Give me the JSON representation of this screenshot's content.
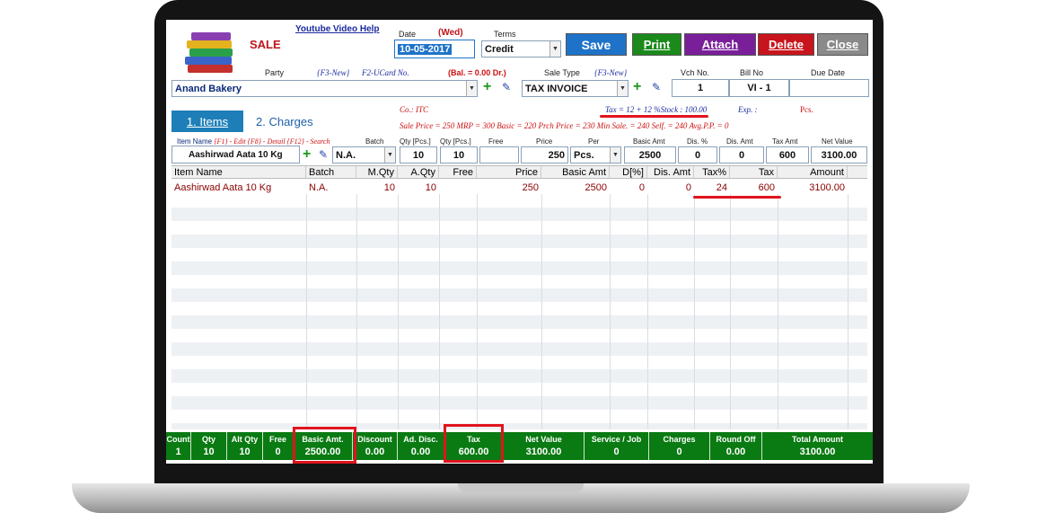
{
  "header": {
    "title": "SALE",
    "help_link": "Youtube Video Help",
    "date_label": "Date",
    "weekday": "(Wed)",
    "date_value": "10-05-2017",
    "terms_label": "Terms",
    "terms_value": "Credit",
    "buttons": {
      "save": "Save",
      "print": "Print",
      "attach": "Attach",
      "delete": "Delete",
      "close": "Close"
    }
  },
  "party": {
    "label": "Party",
    "f3_new": "{F3-New}",
    "f2_ucard": "F2-UCard No.",
    "balance": "(Bal. =  0.00 Dr.)",
    "value": "Anand Bakery",
    "sale_type_label": "Sale Type",
    "sale_type_f3": "{F3-New}",
    "sale_type_value": "TAX INVOICE",
    "vch_label": "Vch No.",
    "vch_value": "1",
    "bill_label": "Bill No",
    "bill_value": "VI - 1",
    "due_label": "Due Date",
    "due_value": ""
  },
  "tabs": {
    "items": "1. Items",
    "charges": "2. Charges"
  },
  "info": {
    "company": "Co.: ITC",
    "tax_stock": "Tax = 12 + 12 %Stock : 100.00",
    "exp": "Exp. :",
    "pcs": "Pcs.",
    "prices": "Sale Price = 250    MRP = 300    Basic = 220    Prch Price = 230    Min Sale. = 240    Self. = 240    Avg.P.P. = 0"
  },
  "entry": {
    "item_name_label": "Item Name",
    "hints": "{F1} - Edit  {F8} - Detail  {F12} - Search",
    "batch_label": "Batch",
    "qty_label": "Qty [Pcs.]",
    "qty2_label": "Qty [Pcs.]",
    "free_label": "Free",
    "price_label": "Price",
    "per_label": "Per",
    "basic_amt_label": "Basic Amt",
    "dis_pct_label": "Dis. %",
    "dis_amt_label": "Dis. Amt",
    "tax_amt_label": "Tax Amt",
    "net_value_label": "Net Value",
    "item_value": "Aashirwad Aata 10 Kg",
    "batch_value": "N.A.",
    "qty_value": "10",
    "qty2_value": "10",
    "free_value": "",
    "price_value": "250",
    "per_value": "Pcs.",
    "basic_amt_value": "2500",
    "dis_pct_value": "0",
    "dis_amt_value": "0",
    "tax_amt_value": "600",
    "net_value_value": "3100.00"
  },
  "grid": {
    "columns": [
      "Item Name",
      "Batch",
      "M.Qty",
      "A.Qty",
      "Free",
      "Price",
      "Basic Amt",
      "D[%]",
      "Dis. Amt",
      "Tax%",
      "Tax",
      "Amount"
    ],
    "rows": [
      [
        "Aashirwad Aata 10 Kg",
        "N.A.",
        "10",
        "10",
        "",
        "250",
        "2500",
        "0",
        "0",
        "24",
        "600",
        "3100.00"
      ]
    ]
  },
  "footer": {
    "count": {
      "label": "Count",
      "value": "1"
    },
    "qty": {
      "label": "Qty",
      "value": "10"
    },
    "alt_qty": {
      "label": "Alt Qty",
      "value": "10"
    },
    "free": {
      "label": "Free",
      "value": "0"
    },
    "basic_amt": {
      "label": "Basic Amt.",
      "value": "2500.00"
    },
    "discount": {
      "label": "Discount",
      "value": "0.00"
    },
    "ad_disc": {
      "label": "Ad. Disc.",
      "value": "0.00"
    },
    "tax": {
      "label": "Tax",
      "value": "600.00"
    },
    "net_value": {
      "label": "Net Value",
      "value": "3100.00"
    },
    "service_job": {
      "label": "Service / Job",
      "value": "0"
    },
    "charges": {
      "label": "Charges",
      "value": "0"
    },
    "round_off": {
      "label": "Round Off",
      "value": "0.00"
    },
    "total_amount": {
      "label": "Total Amount",
      "value": "3100.00"
    }
  },
  "icons": {
    "logo": "books-stack-icon",
    "add": "plus-icon",
    "edit": "pencil-icon",
    "dropdown": "chevron-down-icon"
  },
  "colors": {
    "save": "#1e73c8",
    "print": "#1b8a1b",
    "attach": "#7a1f9a",
    "delete": "#c8141c",
    "close": "#8a8a8a",
    "footer": "#0a7a12",
    "highlight": "#e0141e"
  }
}
